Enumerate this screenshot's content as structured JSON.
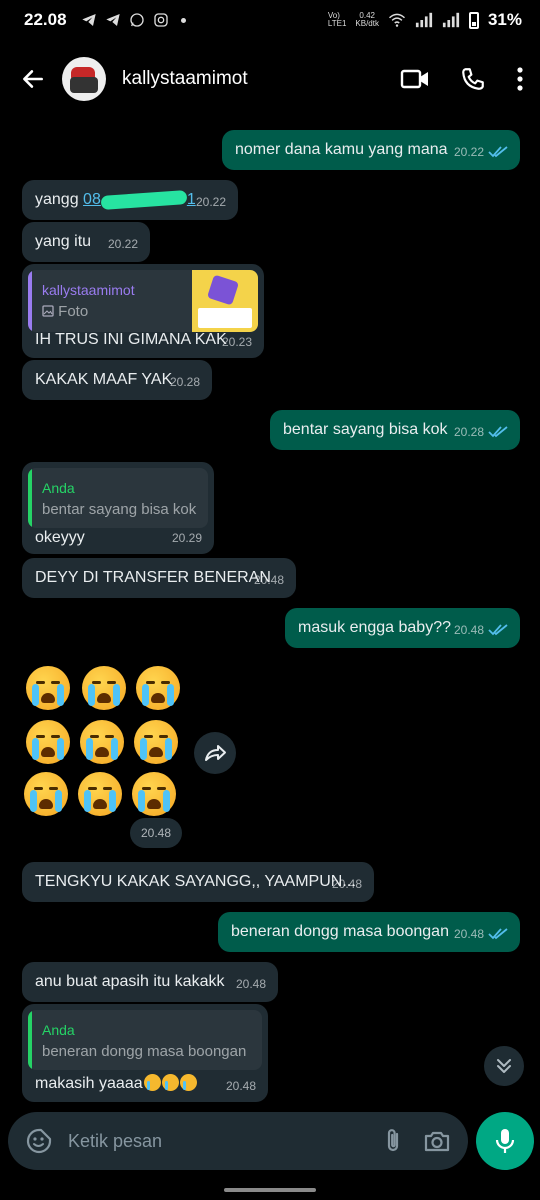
{
  "status_bar": {
    "time": "22.08",
    "volte_lines": [
      "Vo)",
      "LTE1"
    ],
    "net_speed_value": "0.42",
    "net_speed_unit": "KB/dtk",
    "battery": "31%",
    "notification_icons": [
      "telegram-icon",
      "telegram-icon",
      "whatsapp-icon",
      "instagram-icon",
      "dot"
    ]
  },
  "header": {
    "contact_name": "kallystaamimot"
  },
  "messages": [
    {
      "id": "m1",
      "dir": "out",
      "text": "nomer dana kamu yang mana",
      "time": "20.22",
      "read": true
    },
    {
      "id": "m2",
      "dir": "in",
      "text_prefix": "yangg",
      "link_visible": "08",
      "link_tail": "1",
      "time": "20.22"
    },
    {
      "id": "m3",
      "dir": "in",
      "text": "yang itu",
      "time": "20.22"
    },
    {
      "id": "m4",
      "dir": "in",
      "quote_name": "kallystaamimot",
      "quote_sub": "Foto",
      "text": "IH TRUS INI GIMANA KAK",
      "time": "20.23"
    },
    {
      "id": "m5",
      "dir": "in",
      "text": "KAKAK MAAF YAK",
      "time": "20.28"
    },
    {
      "id": "m6",
      "dir": "out",
      "text": "bentar sayang bisa kok",
      "time": "20.28",
      "read": true
    },
    {
      "id": "m7",
      "dir": "in",
      "quote_name": "Anda",
      "quote_sub": "bentar sayang bisa kok",
      "text": "okeyyy",
      "time": "20.29"
    },
    {
      "id": "m8",
      "dir": "in",
      "text": "DEYY DI TRANSFER BENERAN",
      "time": "20.48"
    },
    {
      "id": "m9",
      "dir": "out",
      "text": "masuk engga baby??",
      "time": "20.48",
      "read": true
    },
    {
      "id": "m10",
      "dir": "in",
      "emoji_name": "loudly-crying-face",
      "emoji_count": 9,
      "time": "20.48"
    },
    {
      "id": "m11",
      "dir": "in",
      "text": "TENGKYU KAKAK SAYANGG,, YAAMPUN...",
      "time": "20.48"
    },
    {
      "id": "m12",
      "dir": "out",
      "text": "beneran dongg masa boongan",
      "time": "20.48",
      "read": true
    },
    {
      "id": "m13",
      "dir": "in",
      "text": "anu buat apasih itu kakakk",
      "time": "20.48"
    },
    {
      "id": "m14",
      "dir": "in",
      "quote_name": "Anda",
      "quote_sub": "beneran dongg masa boongan",
      "text": "makasih yaaaa",
      "emoji_suffix_count": 3,
      "time": "20.48"
    }
  ],
  "input": {
    "placeholder": "Ketik pesan"
  },
  "colors": {
    "incoming_bubble": "#202c33",
    "outgoing_bubble": "#005c4b",
    "accent_green": "#00a884",
    "read_ticks": "#53bdeb",
    "quote_self": "#25d366",
    "quote_contact": "#9a7cf0"
  }
}
